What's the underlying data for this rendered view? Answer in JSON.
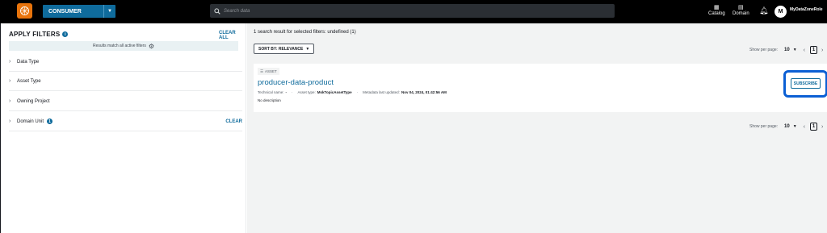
{
  "topbar": {
    "project": "CONSUMER",
    "search_placeholder": "Search data",
    "nav": [
      {
        "label": "Catalog",
        "icon": "catalog-icon"
      },
      {
        "label": "Domain",
        "icon": "domain-icon"
      }
    ],
    "avatar_initial": "M",
    "role": "MyDataZoneRole"
  },
  "filters": {
    "title": "APPLY FILTERS",
    "clear_all": "CLEAR ALL",
    "match_text": "Results match all active filters",
    "items": [
      {
        "label": "Data Type"
      },
      {
        "label": "Asset Type"
      },
      {
        "label": "Owning Project"
      },
      {
        "label": "Domain Unit",
        "clear": "CLEAR",
        "info": "1"
      }
    ]
  },
  "results": {
    "summary": "1 search result for selected filters: undefined (1)",
    "sort_label": "SORT BY: RELEVANCE",
    "pager": {
      "label": "Show per page:",
      "per_page": "10",
      "page": "1"
    },
    "card": {
      "tag": "ASSET",
      "title": "producer-data-product",
      "tech_label": "Technical name:",
      "tech_value": "-",
      "asset_type_label": "Asset type:",
      "asset_type_value": "MskTopicAssetType",
      "updated_label": "Metadata last updated:",
      "updated_value": "Nov 04, 2024, 01:42:56 AM",
      "description": "No description",
      "subscribe": "SUBSCRIBE"
    }
  },
  "colors": {
    "accent": "#0f6b9c",
    "logo": "#e8740c",
    "highlight": "#0b5fd4"
  }
}
